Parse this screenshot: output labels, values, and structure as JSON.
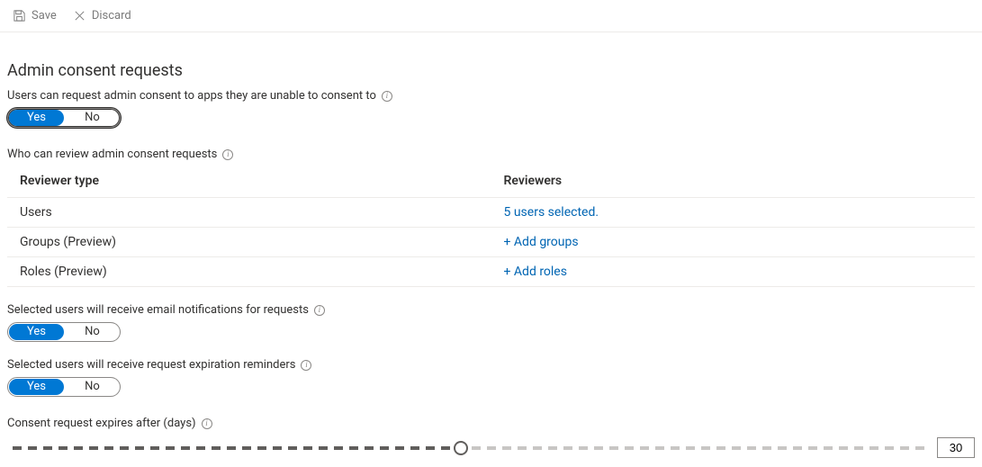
{
  "commandbar": {
    "save_label": "Save",
    "discard_label": "Discard"
  },
  "section_title": "Admin consent requests",
  "enable": {
    "label": "Users can request admin consent to apps they are unable to consent to",
    "yes": "Yes",
    "no": "No"
  },
  "reviewers_heading": "Who can review admin consent requests",
  "reviewers_table": {
    "col_type": "Reviewer type",
    "col_reviewers": "Reviewers",
    "rows": [
      {
        "type": "Users",
        "action": "5 users selected."
      },
      {
        "type": "Groups (Preview)",
        "action": "+ Add groups"
      },
      {
        "type": "Roles (Preview)",
        "action": "+ Add roles"
      }
    ]
  },
  "email_notify": {
    "label": "Selected users will receive email notifications for requests",
    "yes": "Yes",
    "no": "No"
  },
  "expiry_remind": {
    "label": "Selected users will receive request expiration reminders",
    "yes": "Yes",
    "no": "No"
  },
  "expires": {
    "label": "Consent request expires after (days)",
    "value": "30",
    "min": 1,
    "max": 60,
    "ticks": 60
  }
}
